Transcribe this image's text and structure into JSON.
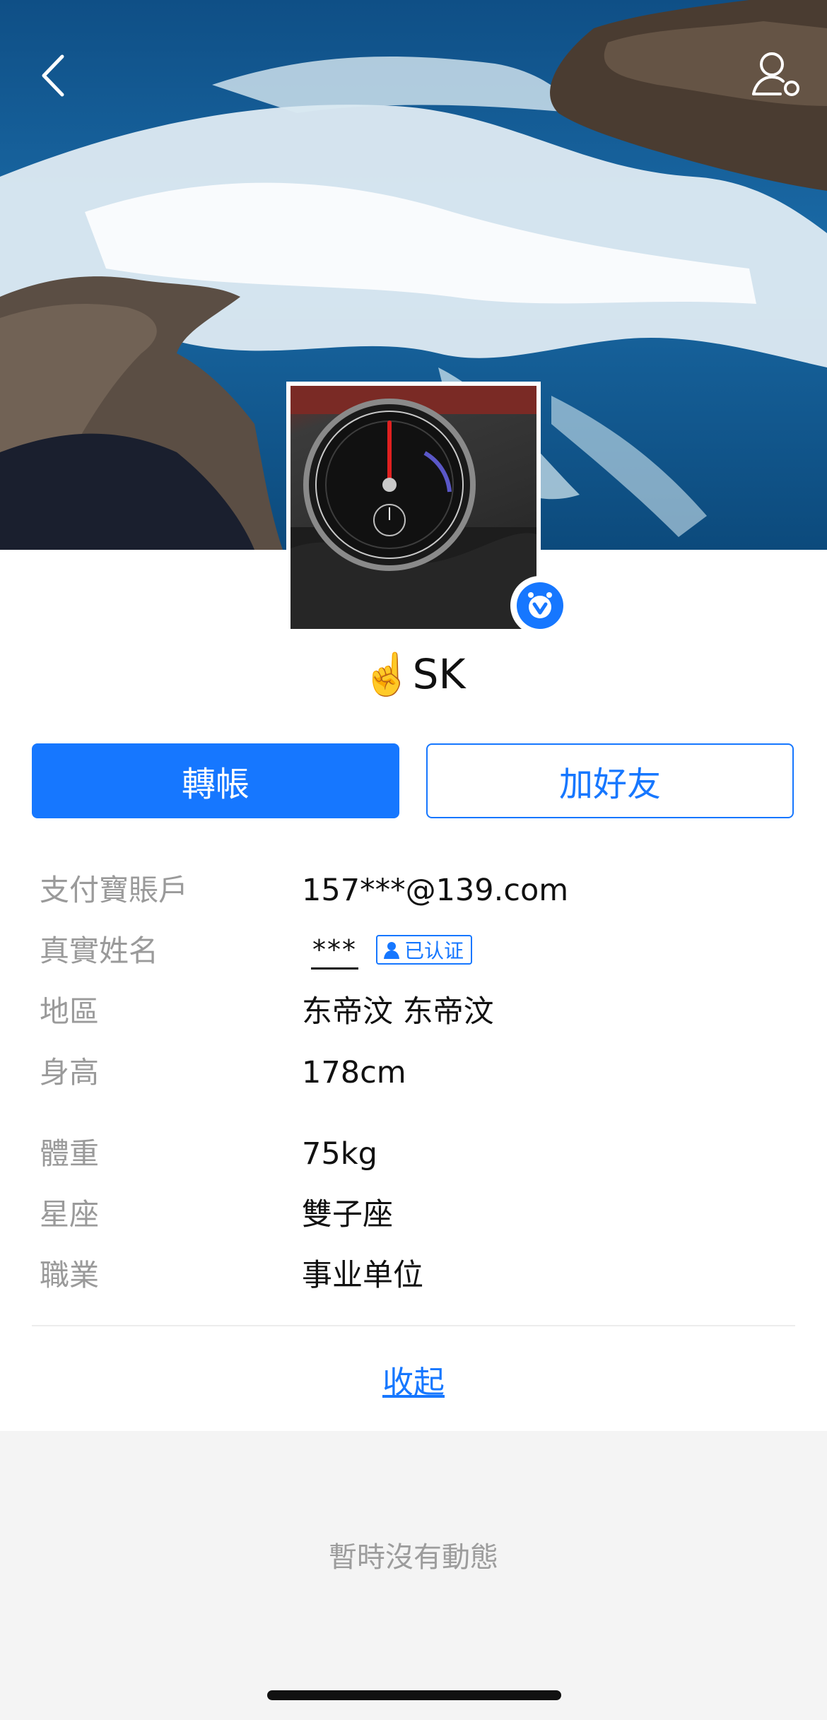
{
  "header": {
    "back_icon": "chevron-left-icon",
    "profile_icon": "user-settings-icon"
  },
  "profile": {
    "display_name": "☝️SK",
    "verified_icon": "verified-v-icon"
  },
  "actions": {
    "transfer_label": "轉帳",
    "add_friend_label": "加好友"
  },
  "info": {
    "alipay_label": "支付寶賬戶",
    "alipay_value": "157***@139.com",
    "real_name_label": "真實姓名",
    "real_name_value": "***",
    "certified_label": "已认证",
    "region_label": "地區",
    "region_value": "东帝汶 东帝汶",
    "height_label": "身高",
    "height_value": "178cm",
    "weight_label": "體重",
    "weight_value": "75kg",
    "zodiac_label": "星座",
    "zodiac_value": "雙子座",
    "job_label": "職業",
    "job_value": "事业单位"
  },
  "collapse_label": "收起",
  "feed": {
    "empty_text": "暫時沒有動態"
  },
  "colors": {
    "accent": "#1677ff",
    "label_gray": "#9a9a9a",
    "feed_bg": "#f4f4f4"
  }
}
